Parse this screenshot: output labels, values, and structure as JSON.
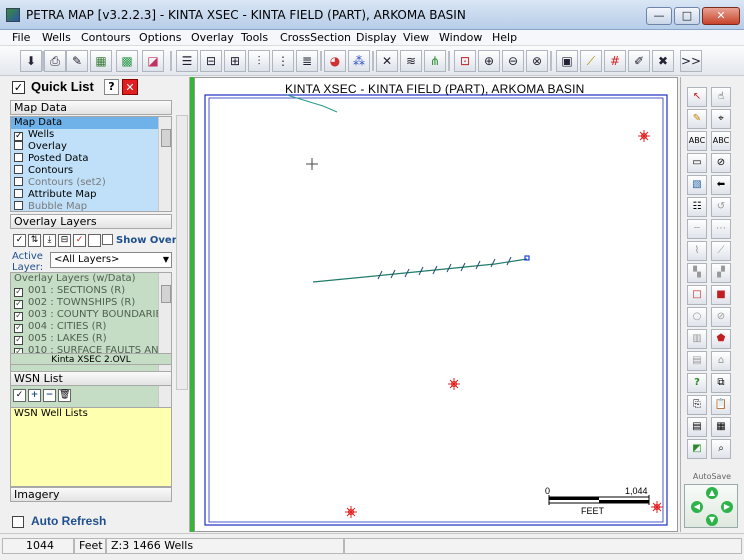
{
  "window": {
    "title": "PETRA MAP [v3.2.2.3] - KINTA XSEC - KINTA FIELD (PART), ARKOMA BASIN",
    "minimize_label": "—",
    "maximize_label": "□",
    "close_label": "✕"
  },
  "menu": [
    "File",
    "Wells",
    "Contours",
    "Options",
    "Overlay",
    "Tools",
    "CrossSection",
    "Display",
    "View",
    "Window",
    "Help"
  ],
  "toolbar": {
    "more_label": ">>"
  },
  "quick_list": {
    "label": "Quick List",
    "help_label": "?",
    "close_label": "✕"
  },
  "map_data": {
    "header": "Map Data",
    "items": [
      {
        "label": "Map Data",
        "checked": false,
        "selected": true
      },
      {
        "label": "Wells",
        "checked": true
      },
      {
        "label": "Overlay",
        "checked": false
      },
      {
        "label": "Posted Data",
        "checked": false
      },
      {
        "label": "Contours",
        "checked": false
      },
      {
        "label": "Contours (set2)",
        "checked": false,
        "dim": true
      },
      {
        "label": "Attribute Map",
        "checked": false
      },
      {
        "label": "Bubble Map",
        "checked": false,
        "dim": true
      }
    ]
  },
  "overlay_layers": {
    "header": "Overlay Layers",
    "show_over_label": "Show Over",
    "active_layer_label": "Active Layer:",
    "active_layer_value": "<All Layers>",
    "list_header": "Overlay Layers (w/Data)",
    "items": [
      {
        "label": "001 : SECTIONS  (R)"
      },
      {
        "label": "002 : TOWNSHIPS  (R)"
      },
      {
        "label": "003 : COUNTY BOUNDARIES"
      },
      {
        "label": "004 : CITIES  (R)"
      },
      {
        "label": "005 : LAKES  (R)"
      },
      {
        "label": "010 : SURFACE FAULTS AN"
      }
    ],
    "file_name": "Kinta XSEC 2.OVL"
  },
  "wsn": {
    "header": "WSN List",
    "list_item": "WSN Well Lists"
  },
  "imagery": {
    "header": "Imagery"
  },
  "auto_refresh_label": "Auto Refresh",
  "map": {
    "title": "KINTA XSEC - KINTA FIELD (PART), ARKOMA BASIN",
    "scale_start": "0",
    "scale_end": "1,044",
    "scale_unit": "FEET"
  },
  "palette": {
    "autosave_label": "AutoSave"
  },
  "status": {
    "value": "1044",
    "unit": "Feet",
    "zoom_and_wells": "Z:3  1466 Wells"
  }
}
